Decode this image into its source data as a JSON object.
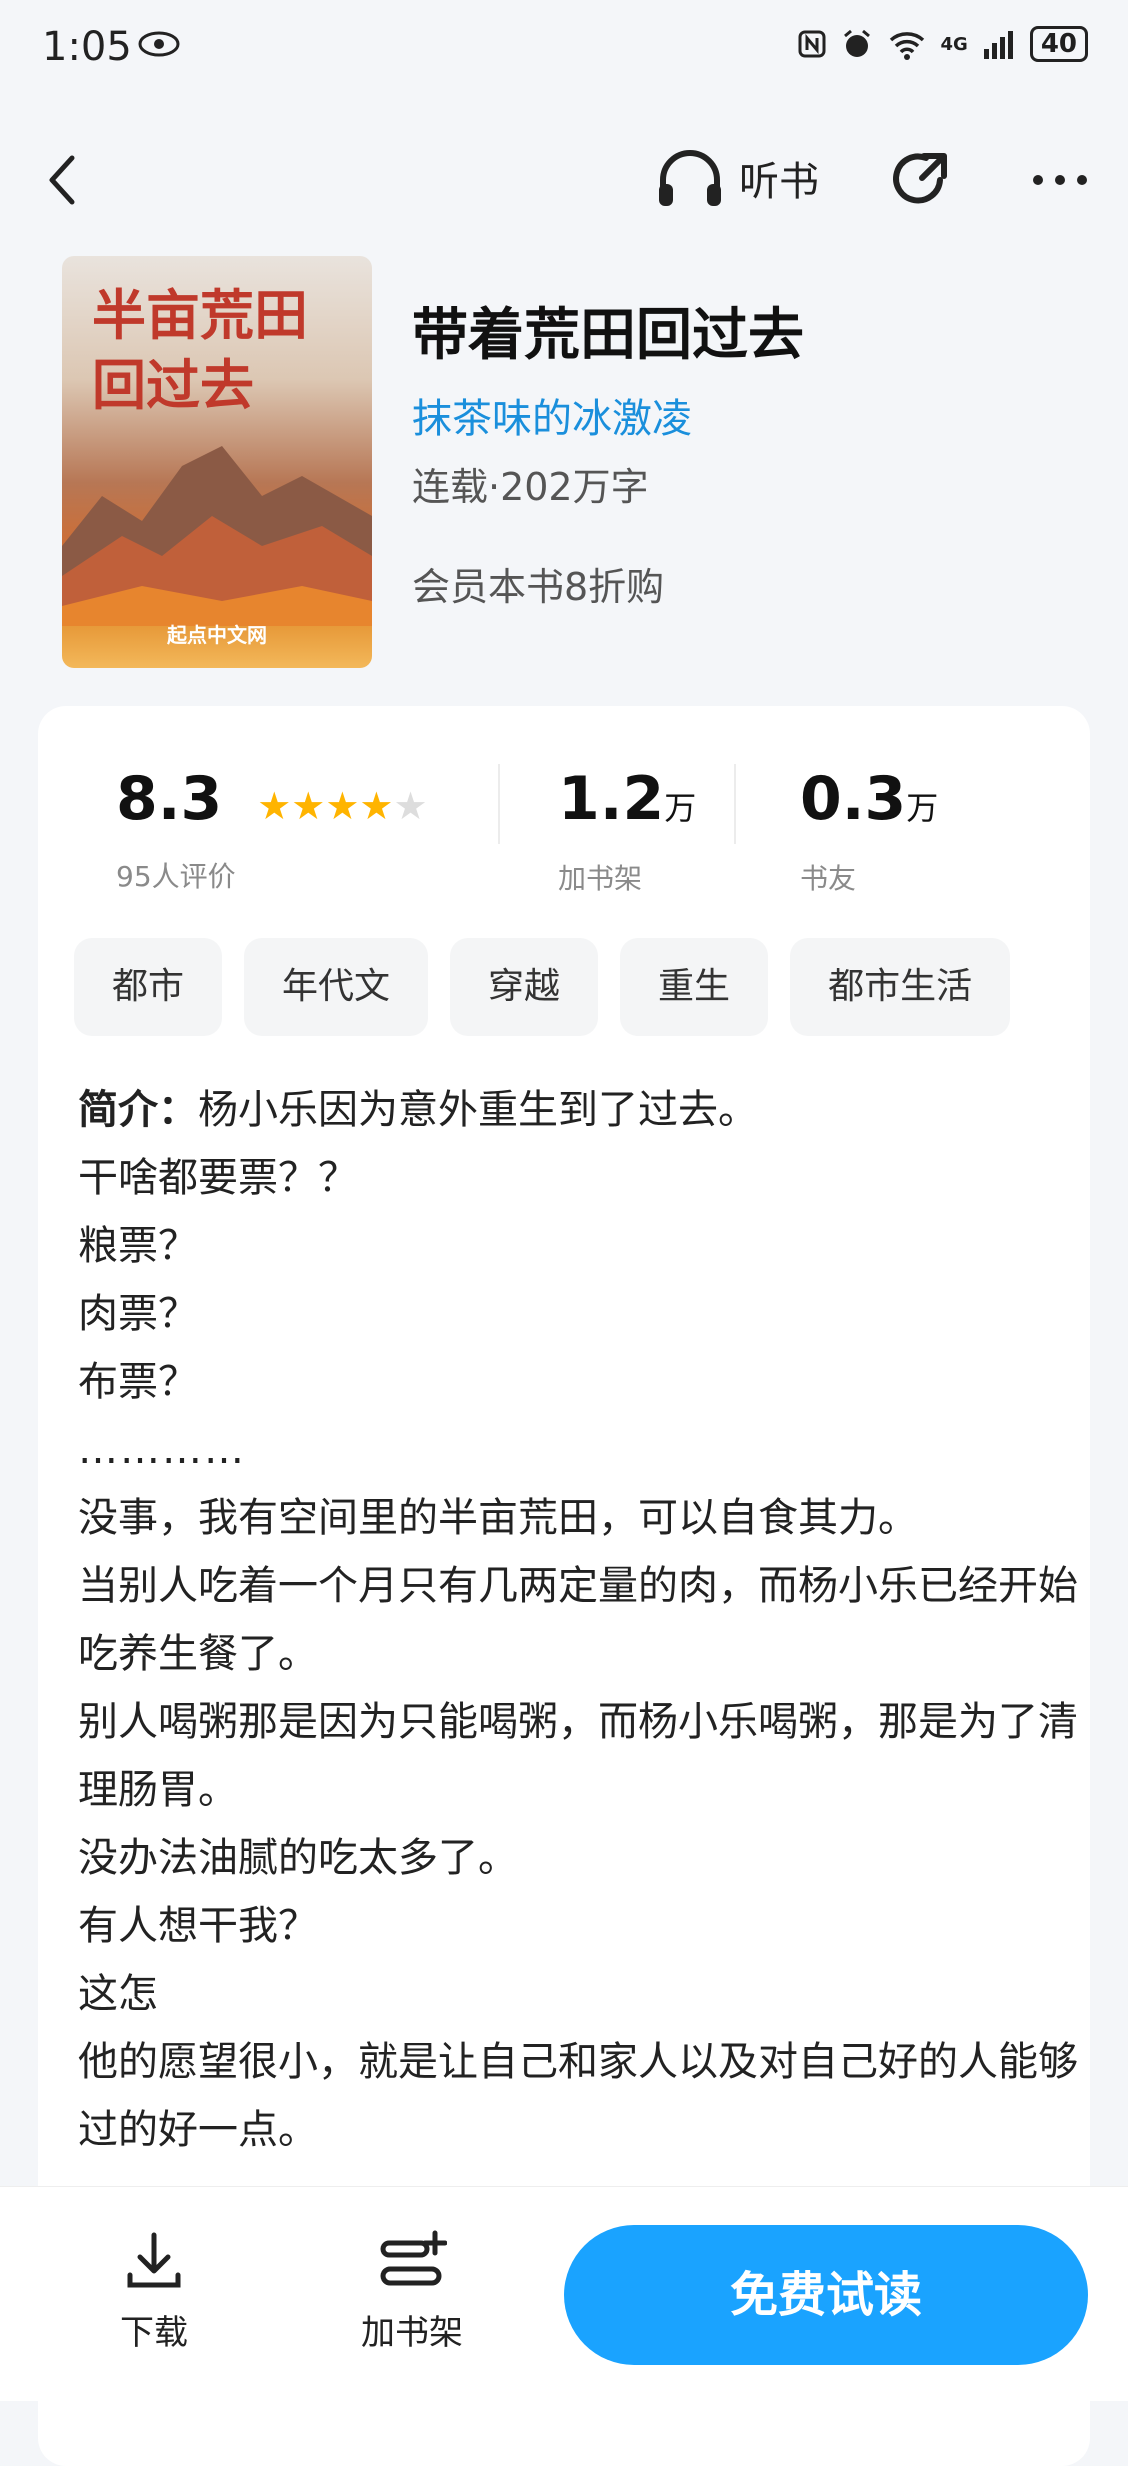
{
  "status": {
    "time": "1:05",
    "network": "4G",
    "battery": "40"
  },
  "topbar": {
    "listen_label": "听书"
  },
  "book": {
    "cover_title_line1": "半亩荒田",
    "cover_title_line2": "回过去",
    "cover_publisher": "起点中文网",
    "title": "带着荒田回过去",
    "author": "抹茶味的冰激凌",
    "meta": "连载·202万字",
    "member_offer": "会员本书8折购"
  },
  "stats": {
    "rating": "8.3",
    "rating_stars": 4,
    "rating_label": "95人评价",
    "shelf_num": "1.2",
    "shelf_unit": "万",
    "shelf_label": "加书架",
    "friends_num": "0.3",
    "friends_unit": "万",
    "friends_label": "书友"
  },
  "tags": [
    "都市",
    "年代文",
    "穿越",
    "重生",
    "都市生活"
  ],
  "intro": {
    "label": "简介：",
    "first": "杨小乐因为意外重生到了过去。",
    "lines": [
      "干啥都要票？？",
      "粮票？",
      "肉票？",
      "布票？",
      "…………",
      "没事，我有空间里的半亩荒田，可以自食其力。",
      "当别人吃着一个月只有几两定量的肉，而杨小乐已经开始吃养生餐了。",
      "别人喝粥那是因为只能喝粥，而杨小乐喝粥，那是为了清理肠胃。",
      "没办法油腻的吃太多了。",
      "有人想干我？",
      "这怎",
      "他的愿望很小，就是让自己和家人以及对自己好的人能够过的好一点。"
    ]
  },
  "bottom": {
    "download_label": "下载",
    "shelf_label": "加书架",
    "read_label": "免费试读"
  }
}
